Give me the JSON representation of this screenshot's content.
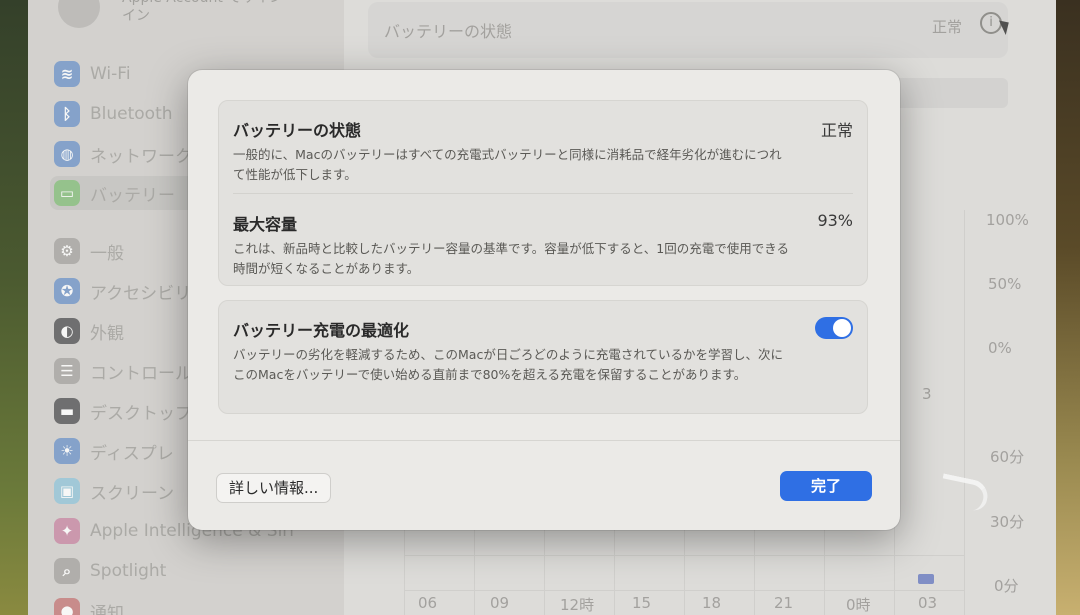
{
  "sidebar": {
    "account_label": "Apple Account でサイン\nイン",
    "items": [
      {
        "label": "Wi-Fi",
        "icon": "wifi-icon",
        "color": "#3b82e8"
      },
      {
        "label": "Bluetooth",
        "icon": "bluetooth-icon",
        "color": "#3b82e8"
      },
      {
        "label": "ネットワーク",
        "icon": "globe-icon",
        "color": "#3b82e8"
      },
      {
        "label": "バッテリー",
        "icon": "battery-icon",
        "color": "#39b54a"
      },
      {
        "label": "一般",
        "icon": "gear-icon",
        "color": "#8e8e93"
      },
      {
        "label": "アクセシビリ",
        "icon": "accessibility-icon",
        "color": "#3b82e8"
      },
      {
        "label": "外観",
        "icon": "appearance-icon",
        "color": "#1c1c1e"
      },
      {
        "label": "コントロール",
        "icon": "control-center-icon",
        "color": "#8e8e93"
      },
      {
        "label": "デスクトップ",
        "icon": "desktop-icon",
        "color": "#1c1c1e"
      },
      {
        "label": "ディスプレ",
        "icon": "display-icon",
        "color": "#3b82e8"
      },
      {
        "label": "スクリーン",
        "icon": "screensaver-icon",
        "color": "#5ac8fa"
      },
      {
        "label": "Apple Intelligence & Siri",
        "icon": "siri-icon",
        "color": "#e0508f"
      },
      {
        "label": "Spotlight",
        "icon": "spotlight-icon",
        "color": "#8e8e93"
      },
      {
        "label": "通知",
        "icon": "notifications-icon",
        "color": "#e04848"
      }
    ]
  },
  "main": {
    "health_title": "バッテリーの状態",
    "health_status": "正常",
    "chart_y_percent": [
      "100%",
      "50%",
      "0%"
    ],
    "chart_y_minutes": [
      "60分",
      "30分",
      "0分"
    ],
    "chart_x": [
      "06",
      "09",
      "12時",
      "15",
      "18",
      "21",
      "0時",
      "03"
    ],
    "chart_mid_label": "3"
  },
  "sheet": {
    "health_title": "バッテリーの状態",
    "health_value": "正常",
    "health_desc": "一般的に、Macのバッテリーはすべての充電式バッテリーと同様に消耗品で経年劣化が進むにつれて性能が低下します。",
    "capacity_title": "最大容量",
    "capacity_value": "93%",
    "capacity_desc": "これは、新品時と比較したバッテリー容量の基準です。容量が低下すると、1回の充電で使用できる時間が短くなることがあります。",
    "optimize_title": "バッテリー充電の最適化",
    "optimize_desc": "バッテリーの劣化を軽減するため、このMacが日ごろどのように充電されているかを学習し、次にこのMacをバッテリーで使い始める直前まで80%を超える充電を保留することがあります。",
    "optimize_enabled": true,
    "more_info_label": "詳しい情報...",
    "done_label": "完了"
  },
  "colors": {
    "accent": "#2f6fe4",
    "sheet_bg": "#ebeae7"
  }
}
